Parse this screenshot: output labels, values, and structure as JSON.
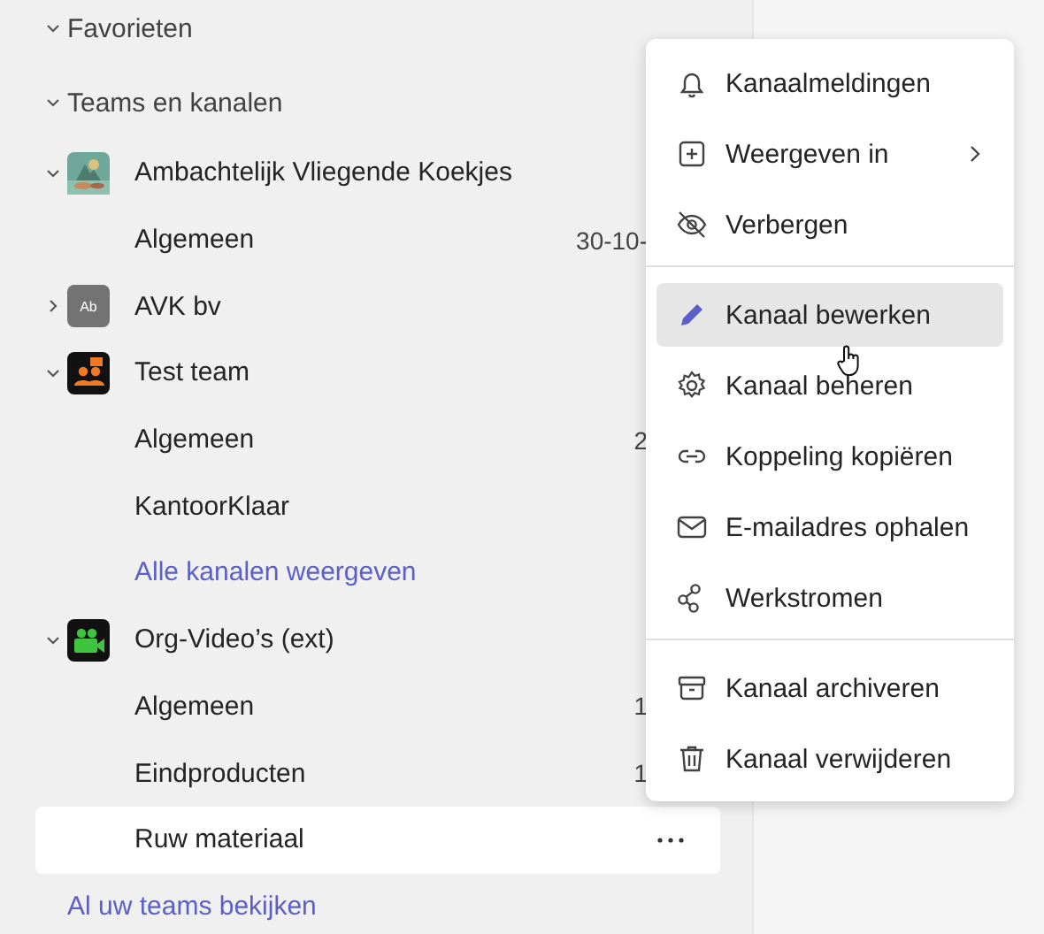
{
  "sections": [
    {
      "label": "Favorieten",
      "expanded": true
    },
    {
      "label": "Teams en kanalen",
      "expanded": true
    }
  ],
  "teams": [
    {
      "name": "Ambachtelijk Vliegende Koekjes",
      "expanded": true,
      "avatar": {
        "kind": "picture"
      },
      "channels": [
        {
          "name": "Algemeen",
          "date": "30-10-",
          "selected": false
        }
      ]
    },
    {
      "name": "AVK bv",
      "expanded": false,
      "avatar": {
        "kind": "initials",
        "text": "Ab"
      }
    },
    {
      "name": "Test team",
      "expanded": true,
      "avatar": {
        "kind": "people"
      },
      "channels": [
        {
          "name": "Algemeen",
          "date": "2",
          "selected": false
        },
        {
          "name": "KantoorKlaar",
          "selected": false
        }
      ],
      "more_link": "Alle kanalen weergeven"
    },
    {
      "name": "Org-Video’s (ext)",
      "expanded": true,
      "avatar": {
        "kind": "camera"
      },
      "channels": [
        {
          "name": "Algemeen",
          "date": "1",
          "selected": false
        },
        {
          "name": "Eindproducten",
          "date": "1",
          "selected": false
        },
        {
          "name": "Ruw materiaal",
          "selected": true
        }
      ]
    }
  ],
  "footer_link": "Al uw teams bekijken",
  "context_menu": {
    "groups": [
      [
        {
          "label": "Kanaalmeldingen",
          "highlighted": false
        },
        {
          "label": "Weergeven in",
          "highlighted": false,
          "submenu": true
        },
        {
          "label": "Verbergen",
          "highlighted": false
        }
      ],
      [
        {
          "label": "Kanaal bewerken",
          "highlighted": true
        },
        {
          "label": "Kanaal beheren",
          "highlighted": false
        },
        {
          "label": "Koppeling kopiëren",
          "highlighted": false
        },
        {
          "label": "E-mailadres ophalen",
          "highlighted": false
        },
        {
          "label": "Werkstromen",
          "highlighted": false
        }
      ],
      [
        {
          "label": "Kanaal archiveren",
          "highlighted": false
        },
        {
          "label": "Kanaal verwijderen",
          "highlighted": false
        }
      ]
    ]
  }
}
